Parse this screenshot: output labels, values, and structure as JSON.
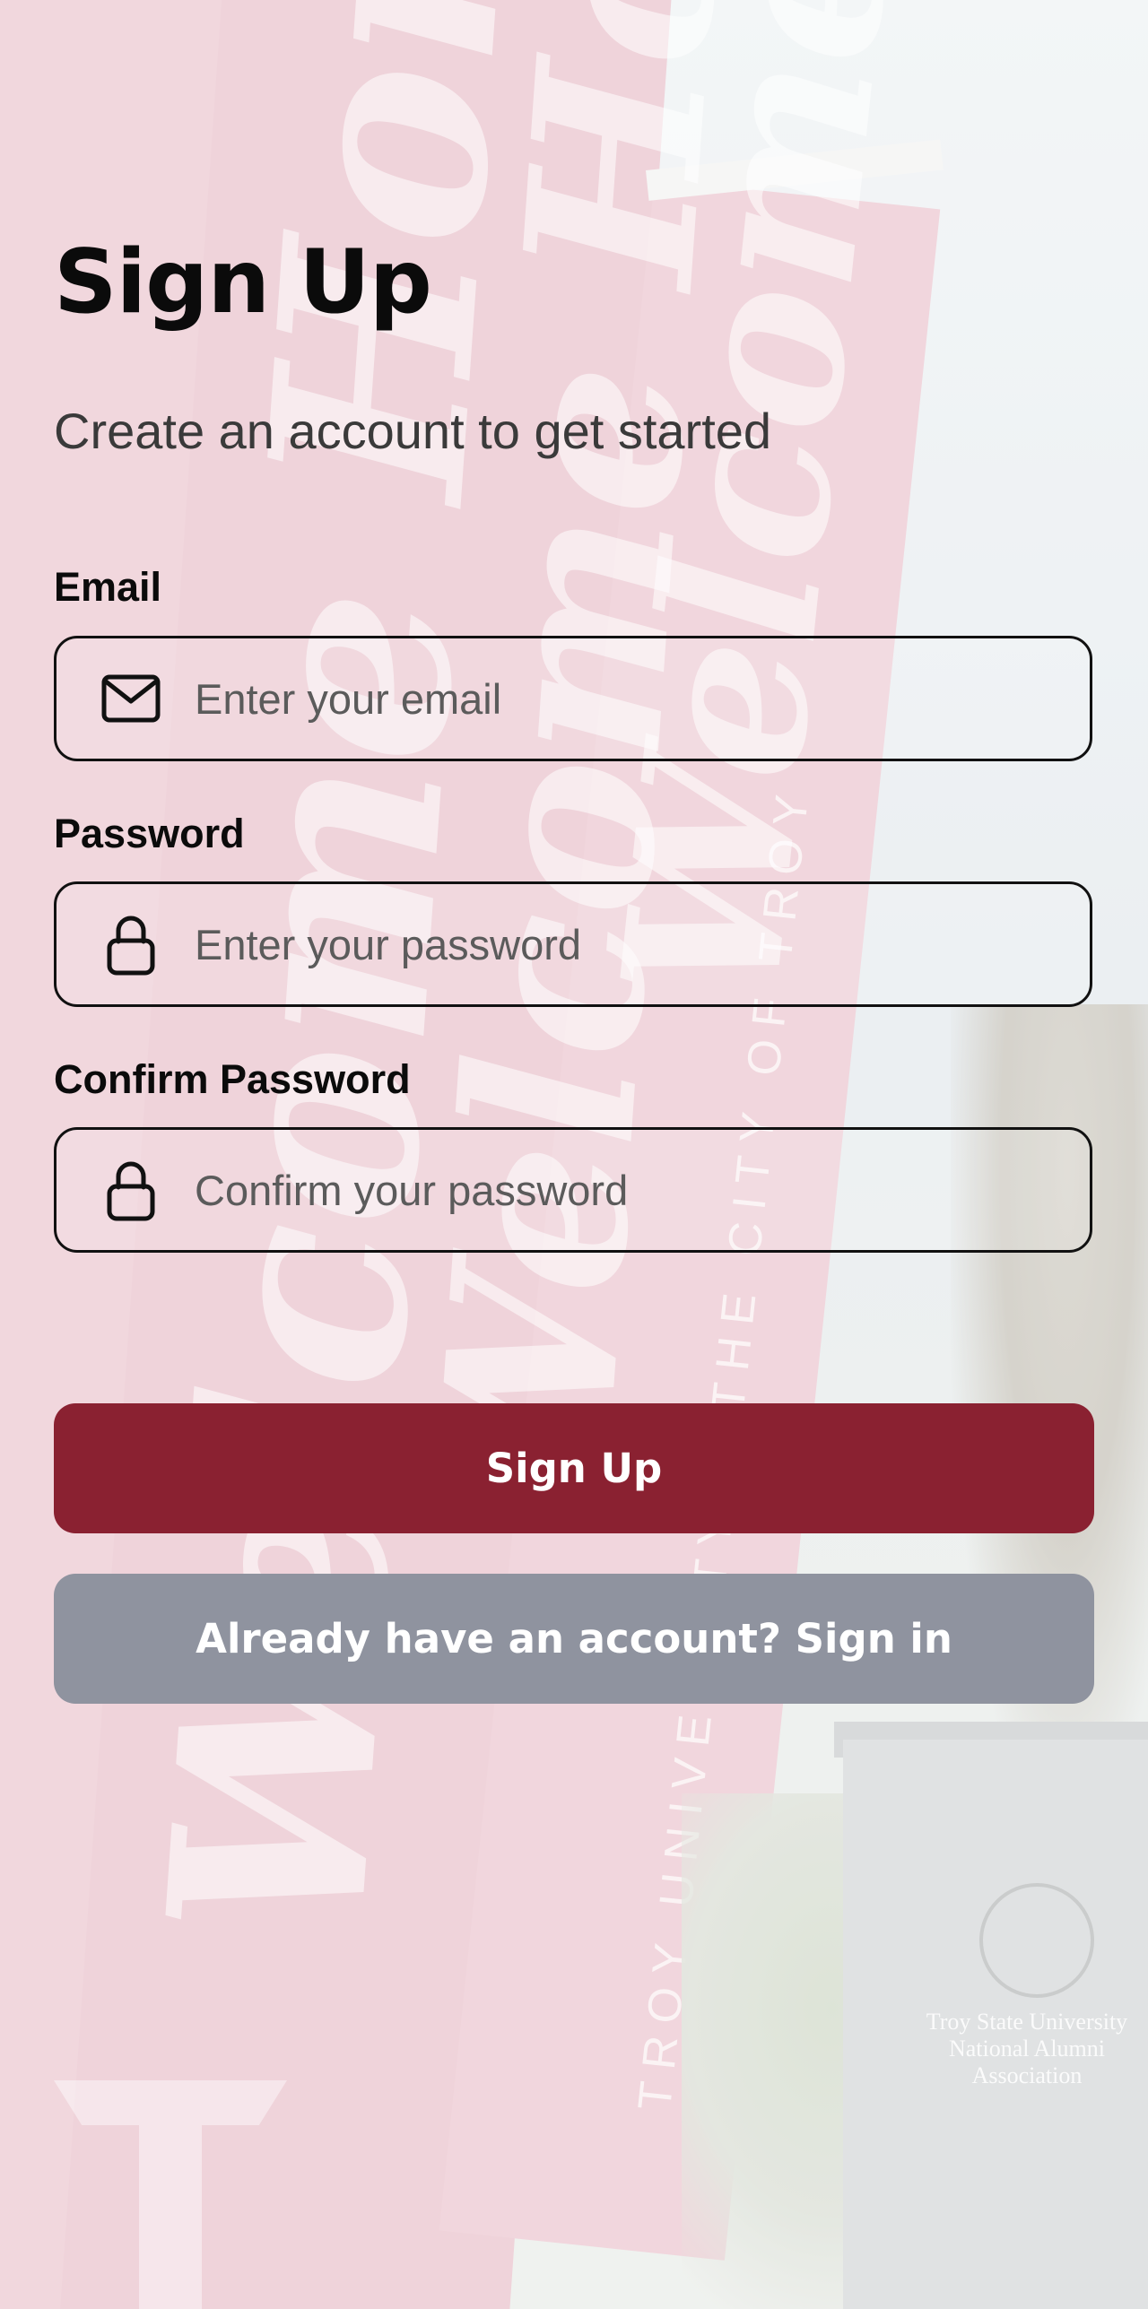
{
  "page": {
    "title": "Sign Up",
    "subtitle": "Create an account to get started"
  },
  "form": {
    "email": {
      "label": "Email",
      "placeholder": "Enter your email",
      "value": "",
      "icon": "mail-icon"
    },
    "password": {
      "label": "Password",
      "placeholder": "Enter your password",
      "value": "",
      "icon": "lock-icon"
    },
    "confirm_password": {
      "label": "Confirm Password",
      "placeholder": "Confirm your password",
      "value": "",
      "icon": "lock-icon"
    }
  },
  "actions": {
    "sign_up_label": "Sign Up",
    "sign_in_label": "Already have an account? Sign in"
  },
  "background": {
    "banner_script": "Welcome Home",
    "banner_caps": "TROY UNIVERSITY & THE CITY OF TROY",
    "plaque_text": "Troy State University National Alumni Association"
  },
  "colors": {
    "primary_button": "#8a2131",
    "secondary_button": "#8f939f",
    "text": "#0b0b0b",
    "input_border": "#111111"
  }
}
